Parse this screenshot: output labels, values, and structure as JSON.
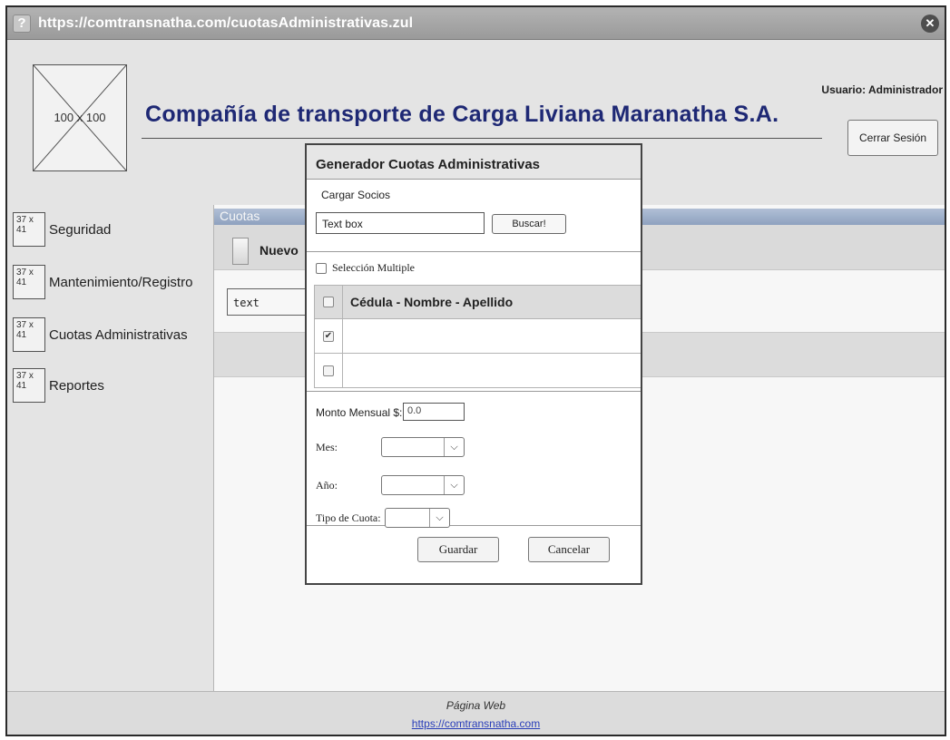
{
  "window": {
    "url": "https://comtransnatha.com/cuotasAdministrativas.zul",
    "help_icon": "question-icon",
    "close_icon": "close-icon"
  },
  "header": {
    "logo_placeholder": "100 x 100",
    "company_name": "Compañía de transporte de Carga Liviana Maranatha S.A.",
    "user_label": "Usuario: Administrador",
    "logout_label": "Cerrar Sesión"
  },
  "sidebar": {
    "icon_placeholder": "37 x 41",
    "items": [
      {
        "label": "Seguridad"
      },
      {
        "label": "Mantenimiento/Registro"
      },
      {
        "label": "Cuotas Administrativas"
      },
      {
        "label": "Reportes"
      }
    ]
  },
  "main": {
    "panel_title": "Cuotas",
    "new_label": "Nuevo",
    "input_value": "text"
  },
  "dialog": {
    "title": "Generador Cuotas Administrativas",
    "load_section_label": "Cargar Socios",
    "textbox_value": "Text box",
    "search_button": "Buscar!",
    "multi_select_label": "Selección Multiple",
    "grid": {
      "header": "Cédula - Nombre - Apellido",
      "rows": [
        {
          "checked": true,
          "text": ""
        },
        {
          "checked": false,
          "text": ""
        }
      ]
    },
    "monthly_amount_label": "Monto Mensual $:",
    "monthly_amount_value": "0.0",
    "month_label": "Mes:",
    "year_label": "Año:",
    "quota_type_label": "Tipo de Cuota:",
    "save_button": "Guardar",
    "cancel_button": "Cancelar"
  },
  "footer": {
    "title": "Página Web",
    "link": "https://comtransnatha.com"
  }
}
